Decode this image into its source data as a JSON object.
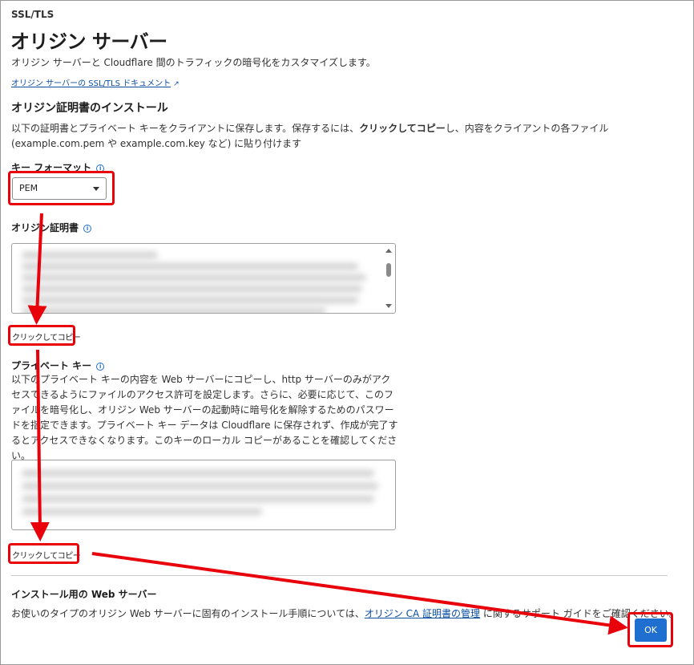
{
  "breadcrumb": "SSL/TLS",
  "page_title": "オリジン サーバー",
  "subtitle": "オリジン サーバーと Cloudflare 間のトラフィックの暗号化をカスタマイズします。",
  "doc_link": "オリジン サーバーの SSL/TLS ドキュメント",
  "install_section": {
    "heading": "オリジン証明書のインストール",
    "desc_part1": "以下の証明書とプライベート キーをクライアントに保存します。保存するには、",
    "desc_bold": "クリックしてコピー",
    "desc_part2": "し、内容をクライアントの各ファイル (example.com.pem や example.com.key など) に貼り付けます"
  },
  "key_format": {
    "label": "キー フォーマット",
    "selected": "PEM"
  },
  "origin_cert": {
    "label": "オリジン証明書",
    "copy_label": "クリックしてコピー"
  },
  "private_key": {
    "label": "プライベート キー",
    "description": "以下のプライベート キーの内容を Web サーバーにコピーし、http サーバーのみがアクセスできるようにファイルのアクセス許可を設定します。さらに、必要に応じて、このファイルを暗号化し、オリジン Web サーバーの起動時に暗号化を解除するためのパスワードを指定できます。プライベート キー データは Cloudflare に保存されず、作成が完了するとアクセスできなくなります。このキーのローカル コピーがあることを確認してください。",
    "copy_label": "クリックしてコピー"
  },
  "web_server": {
    "heading": "インストール用の Web サーバー",
    "text_before": "お使いのタイプのオリジン Web サーバーに固有のインストール手順については、",
    "link": "オリジン CA 証明書の管理",
    "text_after": "に関するサポート ガイドをご確認ください。"
  },
  "ok_button": "OK",
  "colors": {
    "accent": "#1f6fd0",
    "annotation": "#e8000a",
    "link": "#0b4ea2"
  },
  "icons": [
    "info-icon",
    "external-link-icon",
    "chevron-down-icon"
  ]
}
